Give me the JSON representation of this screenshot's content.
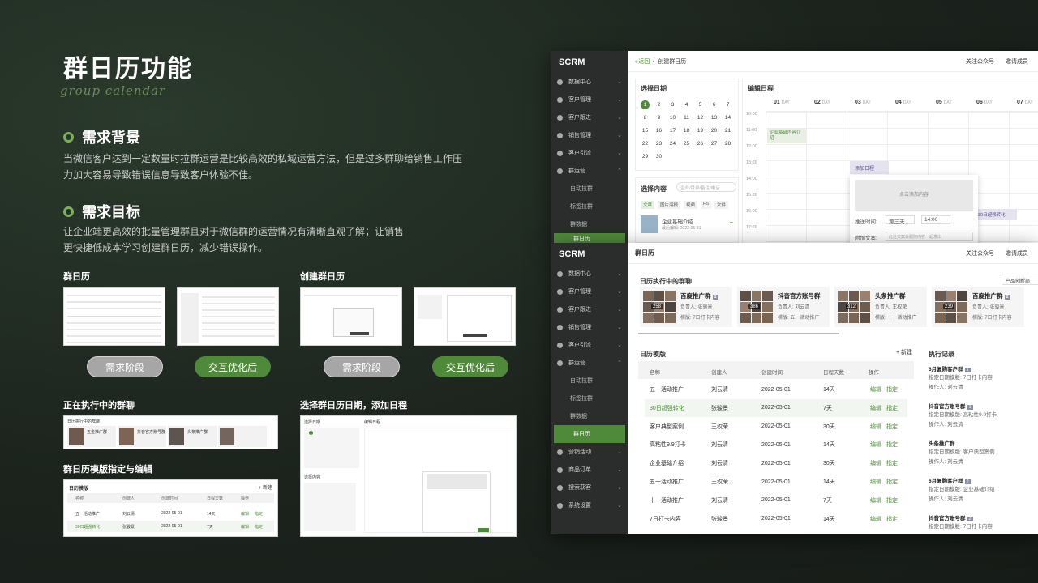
{
  "title": "群日历功能",
  "subtitle": "group calendar",
  "section1": {
    "heading": "需求背景",
    "text": "当微信客户达到一定数量时拉群运营是比较高效的私域运营方法，但是过多群聊给销售工作压力加大容易导致错误信息导致客户体验不佳。"
  },
  "section2": {
    "heading": "需求目标",
    "text": "让企业端更高效的批量管理群且对于微信群的运营情况有清晰直观了解；让销售更快捷低成本学习创建群日历，减少错误操作。"
  },
  "thumbs": {
    "label_calendar": "群日历",
    "label_create": "创建群日历",
    "label_running": "正在执行中的群聊",
    "label_pick": "选择群日历日期，添加日程",
    "label_template": "群日历模版指定与编辑",
    "pill_before": "需求阶段",
    "pill_after": "交互优化后",
    "mini_running_title": "日历执行中的群聊",
    "mini_groups": [
      "五金推广群",
      "抖音官方账号群",
      "头条推广群"
    ],
    "mini_tpl_title": "日历模版",
    "mini_tpl_new": "+ 新建",
    "mini_tpl_headers": [
      "名称",
      "创建人",
      "创建时间",
      "日程天数",
      "操作"
    ],
    "mini_tpl_rows": [
      [
        "五一活动推广",
        "刘云清",
        "2022-05-01",
        "14天",
        "编辑",
        "指定"
      ],
      [
        "30日超强转化",
        "张骏景",
        "2022-05-01",
        "7天",
        "编辑",
        "指定"
      ]
    ],
    "mini_pick_title1": "选择日期",
    "mini_pick_title2": "编辑日程",
    "mini_pick_content": "选择内容"
  },
  "win1": {
    "logo": "SCRM",
    "back": "返回",
    "crumb": "创建群日历",
    "follow": "关注公众号",
    "invite": "邀请成员",
    "pick_date": "选择日期",
    "calendar_days": [
      "1",
      "2",
      "3",
      "4",
      "5",
      "6",
      "7",
      "8",
      "9",
      "10",
      "11",
      "12",
      "13",
      "14",
      "15",
      "16",
      "17",
      "18",
      "19",
      "20",
      "21",
      "22",
      "23",
      "24",
      "25",
      "26",
      "27",
      "28",
      "29",
      "30"
    ],
    "edit_schedule": "编辑日程",
    "day_cols": [
      "01",
      "02",
      "03",
      "04",
      "05",
      "06",
      "07"
    ],
    "day_word": "DAY",
    "times": [
      "10:00",
      "11:00",
      "12:00",
      "13:00",
      "14:00",
      "15:00",
      "16:00",
      "17:00"
    ],
    "event1": "企业基础内容介绍",
    "event2": "添加日程",
    "event3": "30日超强转化",
    "popup_placeholder": "点击添加内容",
    "push_time_label": "推送时间:",
    "push_day": "第三天",
    "push_time": "14:00",
    "attach_label": "附加文案:",
    "attach_placeholder": "此处文案会跟随内容一起发出",
    "choose_content": "选择内容",
    "search_placeholder": "企业/目录/备注/电话",
    "content_tabs": [
      "文章",
      "图片海报",
      "视频",
      "H5",
      "文件"
    ],
    "content_item": "企业基础介绍",
    "content_item_meta": "最后编辑: 2022-05-31"
  },
  "win2": {
    "logo": "SCRM",
    "page_title": "群日历",
    "follow": "关注公众号",
    "invite": "邀请成员",
    "nav": [
      {
        "label": "数据中心"
      },
      {
        "label": "客户管理"
      },
      {
        "label": "客户跟进"
      },
      {
        "label": "销售管理"
      },
      {
        "label": "客户引流"
      },
      {
        "label": "群运营"
      }
    ],
    "nav_sub": [
      "自动拉群",
      "标签拉群",
      "群数据",
      "群日历"
    ],
    "nav_after": [
      {
        "label": "营销活动"
      },
      {
        "label": "商品订单"
      },
      {
        "label": "搜索获客"
      },
      {
        "label": "系统设置"
      }
    ],
    "running_title": "日历执行中的群聊",
    "running_select": "产品创新部",
    "groups": [
      {
        "name": "百度推广群",
        "badge": "1",
        "count": "258",
        "owner_label": "负责人:",
        "owner": "张骏景",
        "tpl_label": "模版:",
        "tpl": "7日打卡内容"
      },
      {
        "name": "抖音官方账号群",
        "badge": "",
        "count": "386",
        "owner_label": "负责人:",
        "owner": "刘云清",
        "tpl_label": "模版:",
        "tpl": "五一活动推广"
      },
      {
        "name": "头条推广群",
        "badge": "",
        "count": "312",
        "owner_label": "负责人:",
        "owner": "王权荣",
        "tpl_label": "模版:",
        "tpl": "十一活动推广"
      },
      {
        "name": "百度推广群",
        "badge": "2",
        "count": "239",
        "owner_label": "负责人:",
        "owner": "张骏景",
        "tpl_label": "模版:",
        "tpl": "7日打卡内容"
      }
    ],
    "tpl_title": "日历模版",
    "tpl_new": "新建",
    "tpl_headers": [
      "名称",
      "创建人",
      "创建时间",
      "日程天数",
      "操作"
    ],
    "tpl_rows": [
      {
        "name": "五一活动推广",
        "creator": "刘云清",
        "date": "2022-05-01",
        "days": "14天",
        "edit": "编辑",
        "assign": "指定"
      },
      {
        "name": "30日超强转化",
        "creator": "张骏景",
        "date": "2022-05-01",
        "days": "7天",
        "edit": "编辑",
        "assign": "指定"
      },
      {
        "name": "客户典型案例",
        "creator": "王权荣",
        "date": "2022-05-01",
        "days": "30天",
        "edit": "编辑",
        "assign": "指定"
      },
      {
        "name": "高粘性9.9打卡",
        "creator": "刘云清",
        "date": "2022-05-01",
        "days": "14天",
        "edit": "编辑",
        "assign": "指定"
      },
      {
        "name": "企业基础介绍",
        "creator": "刘云清",
        "date": "2022-05-01",
        "days": "30天",
        "edit": "编辑",
        "assign": "指定"
      },
      {
        "name": "五一活动推广",
        "creator": "王权荣",
        "date": "2022-05-01",
        "days": "14天",
        "edit": "编辑",
        "assign": "指定"
      },
      {
        "name": "十一活动推广",
        "creator": "刘云清",
        "date": "2022-05-01",
        "days": "7天",
        "edit": "编辑",
        "assign": "指定"
      },
      {
        "name": "7日打卡内容",
        "creator": "张骏景",
        "date": "2022-05-01",
        "days": "14天",
        "edit": "编辑",
        "assign": "指定"
      }
    ],
    "log_title": "执行记录",
    "logs": [
      {
        "group": "6月复购客户群",
        "badge": "1",
        "l1": "指定日期模版: 7日打卡内容",
        "l2": "操作人: 刘云清"
      },
      {
        "group": "抖音官方账号群",
        "badge": "1",
        "l1": "指定日期模版: 高粘性9.9打卡",
        "l2": "操作人: 刘云清"
      },
      {
        "group": "头条推广群",
        "badge": "",
        "l1": "指定日期模版: 客户典型案例",
        "l2": "操作人: 刘云清"
      },
      {
        "group": "6月复购客户群",
        "badge": "2",
        "l1": "指定日期模版: 企业基础介绍",
        "l2": "操作人: 刘云清"
      },
      {
        "group": "抖音官方账号群",
        "badge": "2",
        "l1": "指定日期模版: 7日打卡内容",
        "l2": ""
      }
    ]
  }
}
